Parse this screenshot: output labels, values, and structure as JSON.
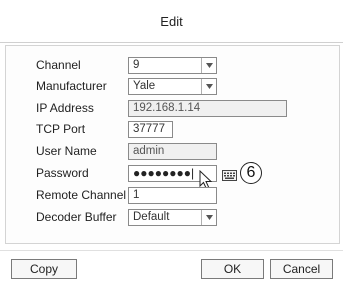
{
  "dialog": {
    "title": "Edit"
  },
  "form": {
    "channel": {
      "label": "Channel",
      "value": "9"
    },
    "manufacturer": {
      "label": "Manufacturer",
      "value": "Yale"
    },
    "ip_address": {
      "label": "IP Address",
      "value": "192.168.1.14"
    },
    "tcp_port": {
      "label": "TCP Port",
      "value": "37777"
    },
    "user_name": {
      "label": "User Name",
      "value": "admin"
    },
    "password": {
      "label": "Password",
      "value": "●●●●●●●●|"
    },
    "remote_channel": {
      "label": "Remote Channel",
      "value": "1"
    },
    "decoder_buffer": {
      "label": "Decoder Buffer",
      "value": "Default"
    }
  },
  "callout": {
    "number": "6"
  },
  "buttons": {
    "copy": "Copy",
    "ok": "OK",
    "cancel": "Cancel"
  },
  "icons": {
    "dropdown": "chevron-down-icon",
    "keyboard": "keyboard-icon",
    "cursor": "mouse-pointer-icon"
  }
}
